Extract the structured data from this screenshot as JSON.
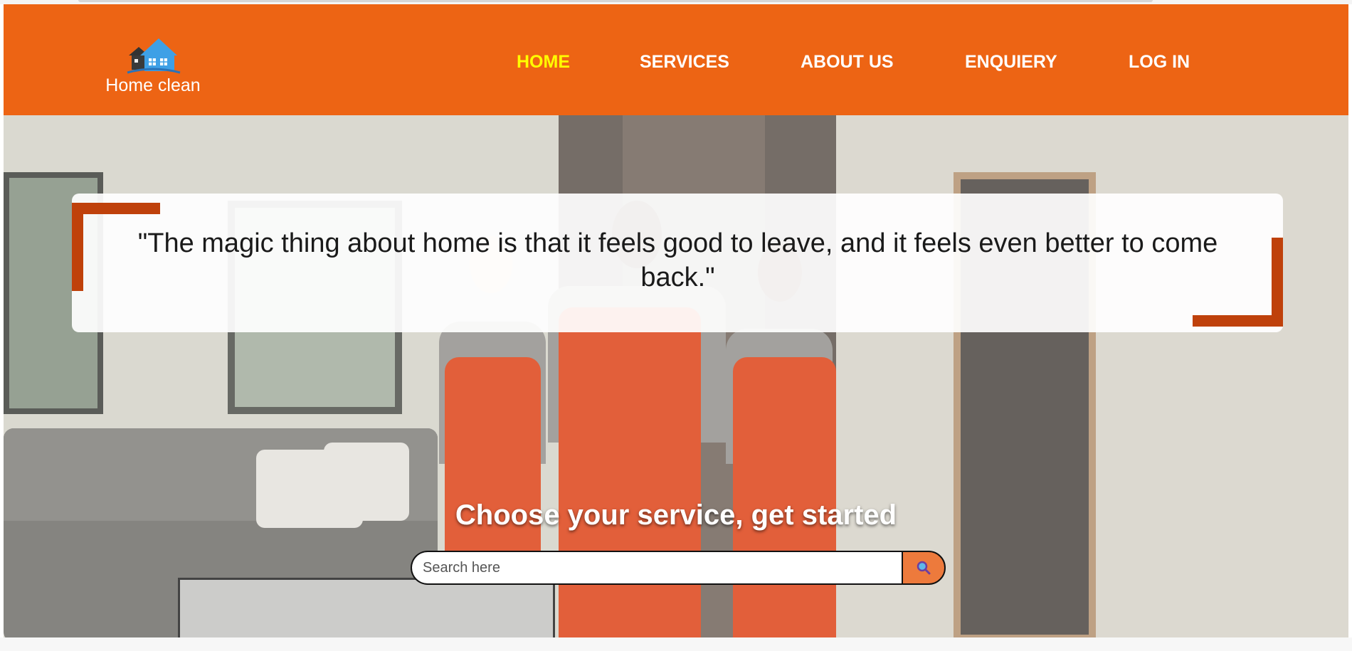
{
  "brand": {
    "name": "Home clean",
    "logo_icon": "house-icon",
    "color": "#ed6414"
  },
  "nav": {
    "items": [
      {
        "label": "HOME",
        "active": true
      },
      {
        "label": "SERVICES",
        "active": false
      },
      {
        "label": "ABOUT US",
        "active": false
      },
      {
        "label": "ENQUIERY",
        "active": false
      },
      {
        "label": "LOG IN",
        "active": false
      }
    ],
    "active_color": "#ffff00"
  },
  "hero": {
    "quote": "\"The magic thing about home is that it feels good to leave, and it feels even better to come back.\"",
    "accent_color": "#bf410b",
    "cta": "Choose your service, get started",
    "search": {
      "placeholder": "Search here",
      "value": "",
      "button_icon": "search-icon"
    }
  }
}
